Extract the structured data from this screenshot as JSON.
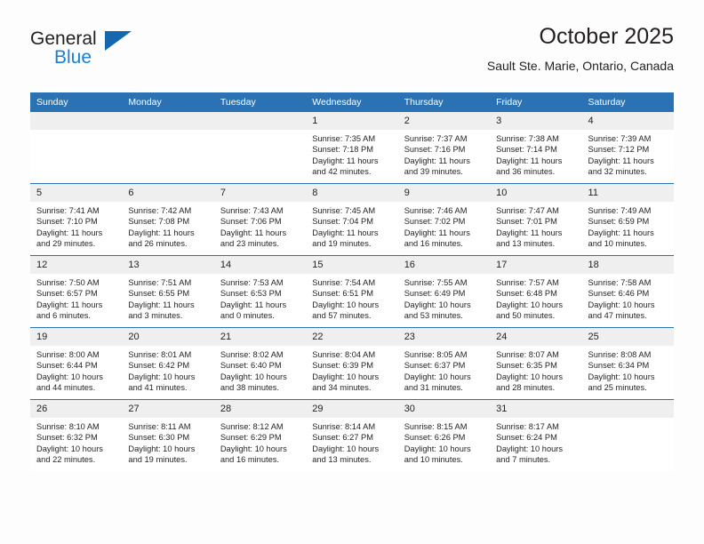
{
  "brand": {
    "name_top": "General",
    "name_bottom": "Blue",
    "triangle_icon": "triangle-icon",
    "color_dark": "#231f20",
    "color_blue": "#1a7fd4"
  },
  "header": {
    "title": "October 2025",
    "subtitle": "Sault Ste. Marie, Ontario, Canada"
  },
  "theme": {
    "header_bg": "#2b72b4",
    "header_text": "#ffffff",
    "daynum_bg": "#efefef",
    "cell_bg": "#ffffff",
    "row_divider": "#2b72b4",
    "body_text": "#231f20"
  },
  "calendar": {
    "weekday_headers": [
      "Sunday",
      "Monday",
      "Tuesday",
      "Wednesday",
      "Thursday",
      "Friday",
      "Saturday"
    ],
    "labels": {
      "sunrise": "Sunrise:",
      "sunset": "Sunset:",
      "daylight": "Daylight:"
    },
    "weeks": [
      [
        {
          "day": "",
          "lines": []
        },
        {
          "day": "",
          "lines": []
        },
        {
          "day": "",
          "lines": []
        },
        {
          "day": "1",
          "lines": [
            "Sunrise: 7:35 AM",
            "Sunset: 7:18 PM",
            "Daylight: 11 hours and 42 minutes."
          ]
        },
        {
          "day": "2",
          "lines": [
            "Sunrise: 7:37 AM",
            "Sunset: 7:16 PM",
            "Daylight: 11 hours and 39 minutes."
          ]
        },
        {
          "day": "3",
          "lines": [
            "Sunrise: 7:38 AM",
            "Sunset: 7:14 PM",
            "Daylight: 11 hours and 36 minutes."
          ]
        },
        {
          "day": "4",
          "lines": [
            "Sunrise: 7:39 AM",
            "Sunset: 7:12 PM",
            "Daylight: 11 hours and 32 minutes."
          ]
        }
      ],
      [
        {
          "day": "5",
          "lines": [
            "Sunrise: 7:41 AM",
            "Sunset: 7:10 PM",
            "Daylight: 11 hours and 29 minutes."
          ]
        },
        {
          "day": "6",
          "lines": [
            "Sunrise: 7:42 AM",
            "Sunset: 7:08 PM",
            "Daylight: 11 hours and 26 minutes."
          ]
        },
        {
          "day": "7",
          "lines": [
            "Sunrise: 7:43 AM",
            "Sunset: 7:06 PM",
            "Daylight: 11 hours and 23 minutes."
          ]
        },
        {
          "day": "8",
          "lines": [
            "Sunrise: 7:45 AM",
            "Sunset: 7:04 PM",
            "Daylight: 11 hours and 19 minutes."
          ]
        },
        {
          "day": "9",
          "lines": [
            "Sunrise: 7:46 AM",
            "Sunset: 7:02 PM",
            "Daylight: 11 hours and 16 minutes."
          ]
        },
        {
          "day": "10",
          "lines": [
            "Sunrise: 7:47 AM",
            "Sunset: 7:01 PM",
            "Daylight: 11 hours and 13 minutes."
          ]
        },
        {
          "day": "11",
          "lines": [
            "Sunrise: 7:49 AM",
            "Sunset: 6:59 PM",
            "Daylight: 11 hours and 10 minutes."
          ]
        }
      ],
      [
        {
          "day": "12",
          "lines": [
            "Sunrise: 7:50 AM",
            "Sunset: 6:57 PM",
            "Daylight: 11 hours and 6 minutes."
          ]
        },
        {
          "day": "13",
          "lines": [
            "Sunrise: 7:51 AM",
            "Sunset: 6:55 PM",
            "Daylight: 11 hours and 3 minutes."
          ]
        },
        {
          "day": "14",
          "lines": [
            "Sunrise: 7:53 AM",
            "Sunset: 6:53 PM",
            "Daylight: 11 hours and 0 minutes."
          ]
        },
        {
          "day": "15",
          "lines": [
            "Sunrise: 7:54 AM",
            "Sunset: 6:51 PM",
            "Daylight: 10 hours and 57 minutes."
          ]
        },
        {
          "day": "16",
          "lines": [
            "Sunrise: 7:55 AM",
            "Sunset: 6:49 PM",
            "Daylight: 10 hours and 53 minutes."
          ]
        },
        {
          "day": "17",
          "lines": [
            "Sunrise: 7:57 AM",
            "Sunset: 6:48 PM",
            "Daylight: 10 hours and 50 minutes."
          ]
        },
        {
          "day": "18",
          "lines": [
            "Sunrise: 7:58 AM",
            "Sunset: 6:46 PM",
            "Daylight: 10 hours and 47 minutes."
          ]
        }
      ],
      [
        {
          "day": "19",
          "lines": [
            "Sunrise: 8:00 AM",
            "Sunset: 6:44 PM",
            "Daylight: 10 hours and 44 minutes."
          ]
        },
        {
          "day": "20",
          "lines": [
            "Sunrise: 8:01 AM",
            "Sunset: 6:42 PM",
            "Daylight: 10 hours and 41 minutes."
          ]
        },
        {
          "day": "21",
          "lines": [
            "Sunrise: 8:02 AM",
            "Sunset: 6:40 PM",
            "Daylight: 10 hours and 38 minutes."
          ]
        },
        {
          "day": "22",
          "lines": [
            "Sunrise: 8:04 AM",
            "Sunset: 6:39 PM",
            "Daylight: 10 hours and 34 minutes."
          ]
        },
        {
          "day": "23",
          "lines": [
            "Sunrise: 8:05 AM",
            "Sunset: 6:37 PM",
            "Daylight: 10 hours and 31 minutes."
          ]
        },
        {
          "day": "24",
          "lines": [
            "Sunrise: 8:07 AM",
            "Sunset: 6:35 PM",
            "Daylight: 10 hours and 28 minutes."
          ]
        },
        {
          "day": "25",
          "lines": [
            "Sunrise: 8:08 AM",
            "Sunset: 6:34 PM",
            "Daylight: 10 hours and 25 minutes."
          ]
        }
      ],
      [
        {
          "day": "26",
          "lines": [
            "Sunrise: 8:10 AM",
            "Sunset: 6:32 PM",
            "Daylight: 10 hours and 22 minutes."
          ]
        },
        {
          "day": "27",
          "lines": [
            "Sunrise: 8:11 AM",
            "Sunset: 6:30 PM",
            "Daylight: 10 hours and 19 minutes."
          ]
        },
        {
          "day": "28",
          "lines": [
            "Sunrise: 8:12 AM",
            "Sunset: 6:29 PM",
            "Daylight: 10 hours and 16 minutes."
          ]
        },
        {
          "day": "29",
          "lines": [
            "Sunrise: 8:14 AM",
            "Sunset: 6:27 PM",
            "Daylight: 10 hours and 13 minutes."
          ]
        },
        {
          "day": "30",
          "lines": [
            "Sunrise: 8:15 AM",
            "Sunset: 6:26 PM",
            "Daylight: 10 hours and 10 minutes."
          ]
        },
        {
          "day": "31",
          "lines": [
            "Sunrise: 8:17 AM",
            "Sunset: 6:24 PM",
            "Daylight: 10 hours and 7 minutes."
          ]
        },
        {
          "day": "",
          "lines": []
        }
      ]
    ]
  }
}
